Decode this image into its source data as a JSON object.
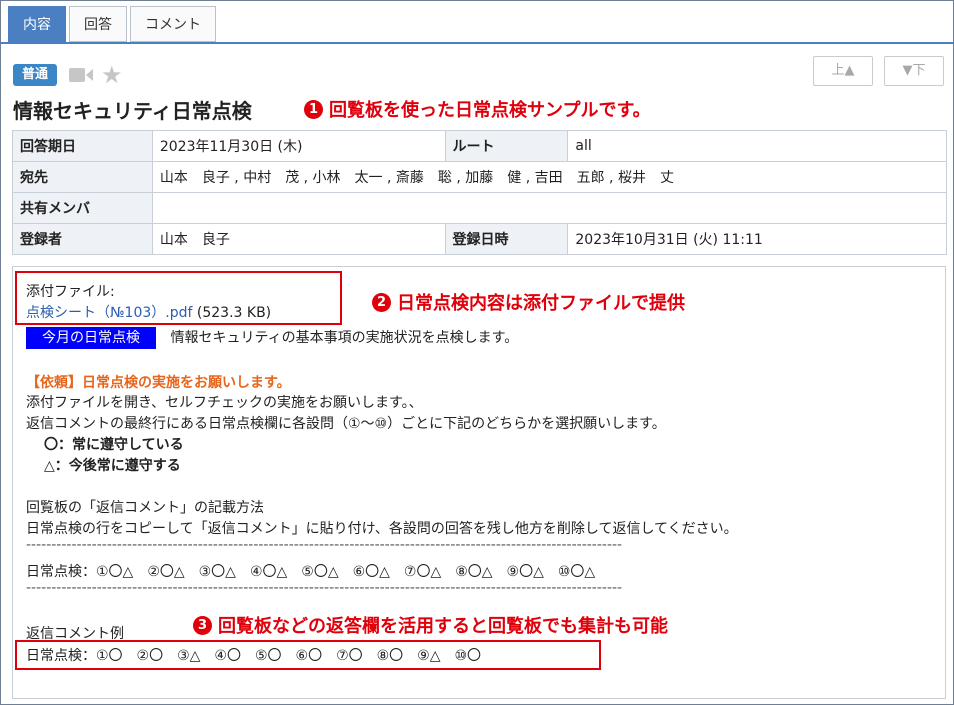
{
  "tabs": [
    {
      "label": "内容",
      "active": true
    },
    {
      "label": "回答",
      "active": false
    },
    {
      "label": "コメント",
      "active": false
    }
  ],
  "header": {
    "priority_badge": "普通",
    "title": "情報セキュリティ日常点検",
    "prev_label": "上▲",
    "next_label": "▼下"
  },
  "callouts": {
    "c1_num": "1",
    "c1_text": "回覧板を使った日常点検サンプルです。",
    "c2_num": "2",
    "c2_text": "日常点検内容は添付ファイルで提供",
    "c3_num": "3",
    "c3_text": "回覧板などの返答欄を活用すると回覧板でも集計も可能"
  },
  "info": {
    "due_label": "回答期日",
    "due_value": "2023年11月30日 (木)",
    "route_label": "ルート",
    "route_value": "all",
    "to_label": "宛先",
    "to_value": "山本　良子 , 中村　茂 , 小林　太一 , 斎藤　聡 , 加藤　健 , 吉田　五郎 , 桜井　丈",
    "share_label": "共有メンバ",
    "share_value": "",
    "author_label": "登録者",
    "author_value": "山本　良子",
    "regdate_label": "登録日時",
    "regdate_value": "2023年10月31日 (火) 11:11"
  },
  "body": {
    "attach_label": "添付ファイル:",
    "attach_file": "点検シート（№103）.pdf",
    "attach_size": "(523.3 KB)",
    "monthly_tag": "今月の日常点検",
    "monthly_desc": "情報セキュリティの基本事項の実施状況を点検します。",
    "request_heading": "【依頼】日常点検の実施をお願いします。",
    "line1": "添付ファイルを開き、セルフチェックの実施をお願いします。、",
    "line2": "返信コメントの最終行にある日常点検欄に各設問（①～⑩）ごとに下記のどちらかを選択願いします。",
    "opt1": "〇：常に遵守している",
    "opt2": "△：今後常に遵守する",
    "method_heading": "回覧板の「返信コメント」の記載方法",
    "method_text": "日常点検の行をコピーして「返信コメント」に貼り付け、各設問の回答を残し他方を削除して返信してください。",
    "divider": "----------------------------------------------------------------------------------------------------------------------",
    "check_line": "日常点検：①〇△　②〇△　③〇△　④〇△　⑤〇△　⑥〇△　⑦〇△　⑧〇△　⑨〇△　⑩〇△",
    "example_heading": "返信コメント例",
    "example_line": "日常点検：①〇　②〇　③△　④〇　⑤〇　⑥〇　⑦〇　⑧〇　⑨△　⑩〇"
  }
}
